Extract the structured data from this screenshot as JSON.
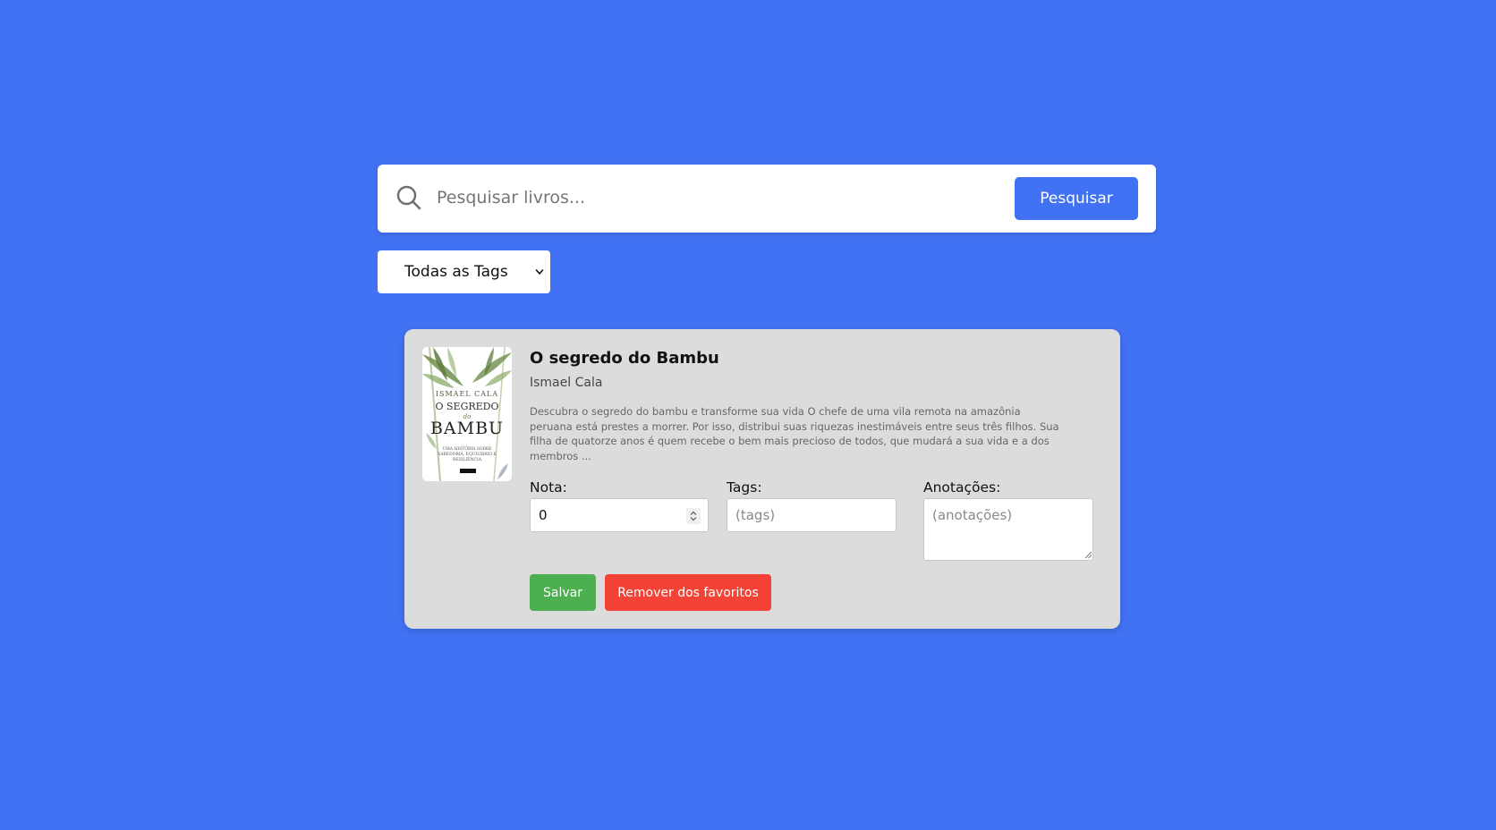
{
  "search": {
    "placeholder": "Pesquisar livros...",
    "button_label": "Pesquisar",
    "icon": "search-icon"
  },
  "tag_filter": {
    "selected": "Todas as Tags",
    "icon": "chevron-down-icon"
  },
  "book": {
    "cover": {
      "author": "ISMAEL CALA",
      "title_top": "O SEGREDO",
      "title_do": "do",
      "title_main": "BAMBU",
      "subtitle": "UMA HISTÓRIA SOBRE SABEDORIA, EQUILÍBRIO E RESILIÊNCIA"
    },
    "title": "O segredo do Bambu",
    "author": "Ismael Cala",
    "description": "Descubra o segredo do bambu e transforme sua vida O chefe de uma vila remota na amazônia peruana está prestes a morrer. Por isso, distribui suas riquezas inestimáveis entre seus três filhos. Sua filha de quatorze anos é quem recebe o bem mais precioso de todos, que mudará a sua vida e a dos membros ...",
    "fields": {
      "nota_label": "Nota:",
      "nota_value": "0",
      "tags_label": "Tags:",
      "tags_placeholder": "(tags)",
      "notes_label": "Anotações:",
      "notes_placeholder": "(anotações)"
    },
    "buttons": {
      "save": "Salvar",
      "remove": "Remover dos favoritos"
    }
  },
  "colors": {
    "background": "#4272f4",
    "primary": "#4272f4",
    "save": "#4caf50",
    "remove": "#f44336",
    "card": "#dcdcdc"
  }
}
